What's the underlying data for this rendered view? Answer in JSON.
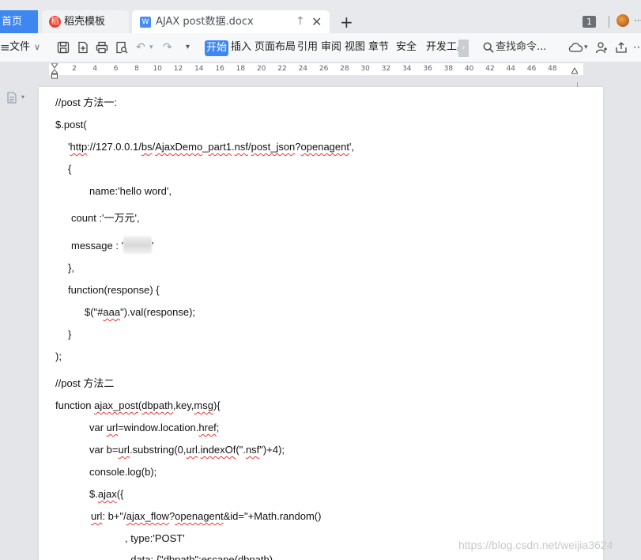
{
  "tabs": {
    "home": "首页",
    "template": "稻壳模板",
    "document": "AJAX post数据.docx",
    "up_arrow": "↑",
    "close": "✕",
    "add": "+",
    "window_count": "1",
    "more": "⋯"
  },
  "ribbon": {
    "menu_glyph": "≡",
    "file": "文件",
    "file_chevron": "∨",
    "undo_chevron": "▾",
    "redo_glyph": "↷",
    "undo_glyph": "↶",
    "more_chevron": "▾",
    "items": [
      "开始",
      "插入",
      "页面布局",
      "引用",
      "审阅",
      "视图",
      "章节",
      "安全",
      "开发工具"
    ],
    "scroll": "›",
    "search": "查找命令...",
    "icons": [
      "save-icon",
      "export-pdf-icon",
      "print-icon",
      "print-preview-icon",
      "undo-icon",
      "redo-icon",
      "search-icon",
      "cloud-icon",
      "share-user-icon",
      "share-icon",
      "more-icon"
    ]
  },
  "ruler": {
    "ticks": [
      "2",
      "4",
      "6",
      "8",
      "10",
      "12",
      "14",
      "16",
      "18",
      "20",
      "22",
      "24",
      "26",
      "28",
      "30",
      "32",
      "34",
      "36",
      "38",
      "40",
      "42",
      "44",
      "46",
      "48"
    ]
  },
  "document": {
    "lines": {
      "l1": "//post 方法一:",
      "l2": "$.post(",
      "l3a": "'",
      "l3b": "http",
      "l3c": "://127.0.0.1/",
      "l3d": "bs",
      "l3e": "/",
      "l3f": "AjaxDemo",
      "l3g": "_",
      "l3h": "part1",
      "l3i": ".",
      "l3j": "nsf",
      "l3k": "/",
      "l3l": "post_json",
      "l3m": "?",
      "l3n": "openagent",
      "l3o": "',",
      "l4": "{",
      "l5": "name:'hello word',",
      "l6": "count :'一万元',",
      "l7a": "message : '",
      "l7b": "'",
      "l8": "},",
      "l9": "function(response) {",
      "l10a": "$(\"#",
      "l10b": "aaa",
      "l10c": "\").val(response);",
      "l11": "}",
      "l12": ");",
      "l13": "//post 方法二",
      "l14a": "function ",
      "l14b": "ajax_post",
      "l14c": "(",
      "l14d": "dbpath",
      "l14e": ",key,",
      "l14f": "msg",
      "l14g": "){",
      "l15a": "var ",
      "l15b": "url",
      "l15c": "=window.location.",
      "l15d": "href",
      "l15e": ";",
      "l16a": "var b=",
      "l16b": "url",
      "l16c": ".substring(0,",
      "l16d": "url",
      "l16e": ".",
      "l16f": "indexOf",
      "l16g": "(\".",
      "l16h": "nsf",
      "l16i": "\")+4);",
      "l17": "console.log(b);",
      "l18a": "$.",
      "l18b": "ajax",
      "l18c": "({",
      "l19a": "url",
      "l19b": ": b+\"/",
      "l19c": "ajax_flow",
      "l19d": "?",
      "l19e": "openagent",
      "l19f": "&id=\"+Math.random()",
      "l20": ", type:'POST'",
      "l21": ", data: {\"dbpath\":escape(dbpath)"
    }
  },
  "watermark": "https://blog.csdn.net/weijia3624"
}
